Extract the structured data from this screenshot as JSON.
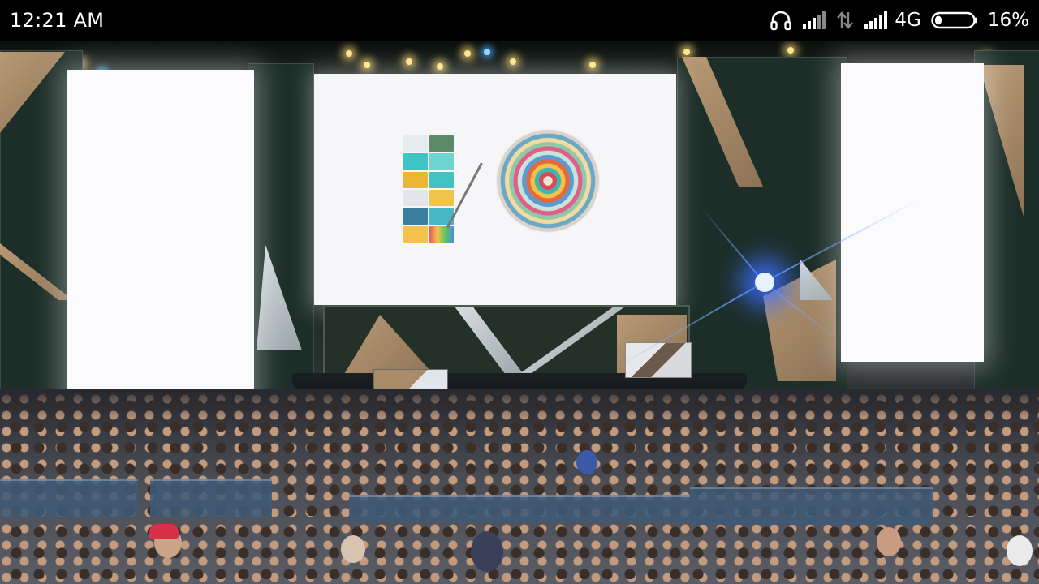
{
  "status_bar": {
    "time": "12:21 AM",
    "network_type": "4G",
    "battery_percent": "16%",
    "battery_level": 0.16,
    "icons": [
      "headset-icon",
      "signal-strength-icon",
      "data-transfer-icon",
      "signal-strength-icon",
      "battery-icon"
    ]
  },
  "scene": {
    "description_colors": {
      "screen_white": "#fbfbfd",
      "stage_green": "#1d2e28",
      "wood": "#b89a74",
      "spotlight_blue": "#3c6eff",
      "barrier_blue": "#3f5a78"
    }
  }
}
